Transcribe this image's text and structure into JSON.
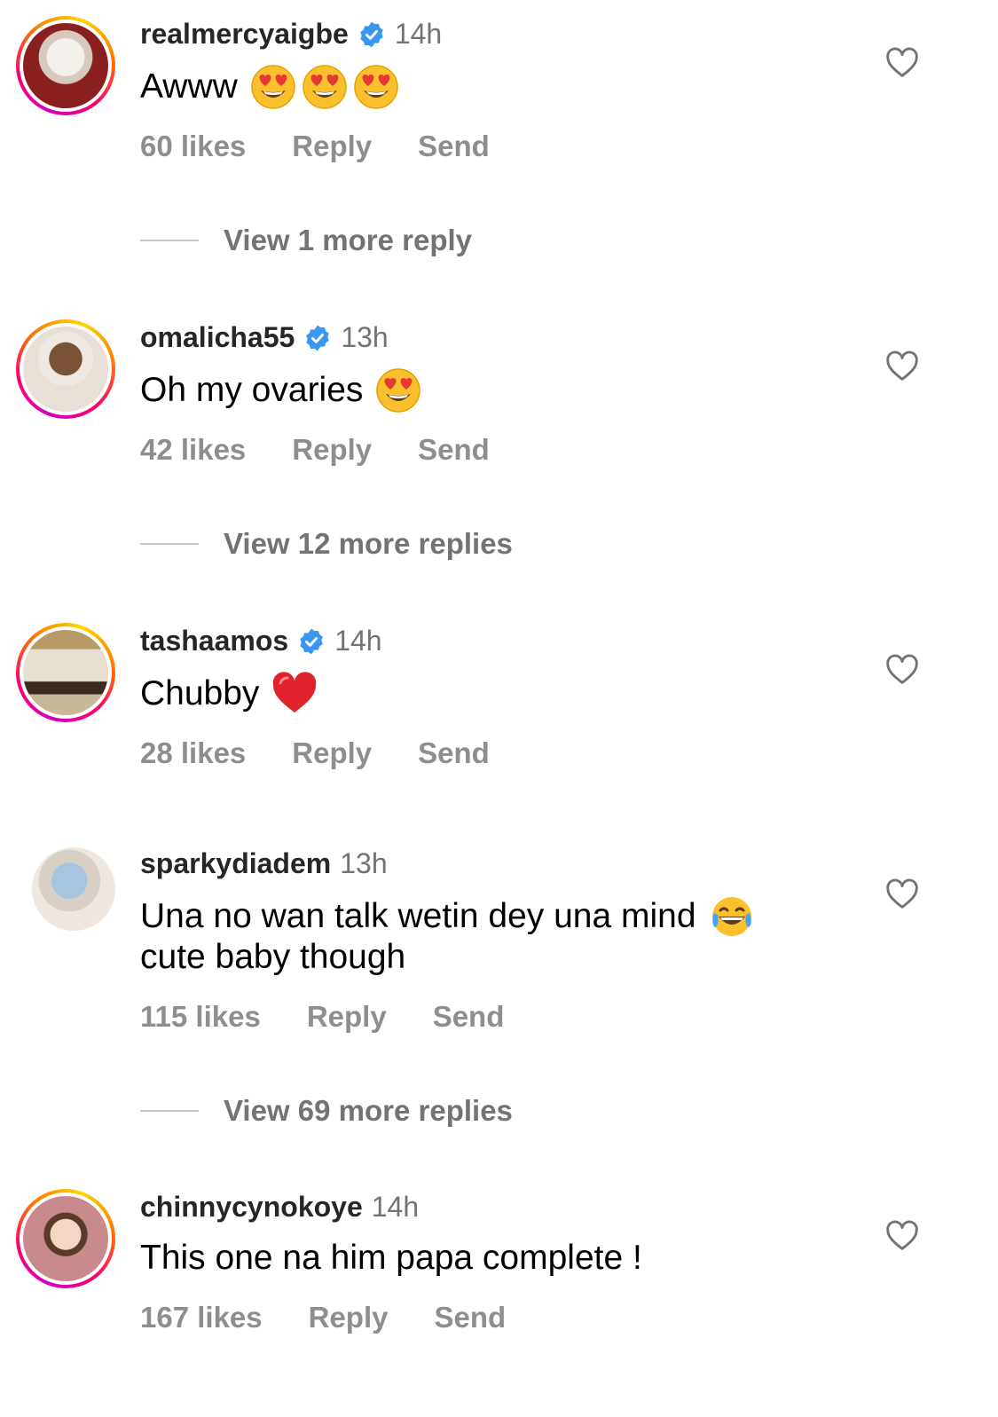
{
  "comments": [
    {
      "username": "realmercyaigbe",
      "verified": true,
      "time": "14h",
      "text": "Awww",
      "emojis": [
        "heart-eyes",
        "heart-eyes",
        "heart-eyes"
      ],
      "likes": "60 likes",
      "reply": "Reply",
      "send": "Send",
      "view_more": "View 1 more reply",
      "story_ring": true
    },
    {
      "username": "omalicha55",
      "verified": true,
      "time": "13h",
      "text": "Oh my ovaries",
      "emojis": [
        "heart-eyes"
      ],
      "likes": "42 likes",
      "reply": "Reply",
      "send": "Send",
      "view_more": "View 12 more replies",
      "story_ring": true
    },
    {
      "username": "tashaamos",
      "verified": true,
      "time": "14h",
      "text": "Chubby",
      "emojis": [
        "red-heart"
      ],
      "likes": "28 likes",
      "reply": "Reply",
      "send": "Send",
      "view_more": "",
      "story_ring": true
    },
    {
      "username": "sparkydiadem",
      "verified": false,
      "time": "13h",
      "text": "Una no wan talk wetin dey una mind",
      "text2": "cute baby though",
      "emojis": [
        "tears-of-joy"
      ],
      "likes": "115 likes",
      "reply": "Reply",
      "send": "Send",
      "view_more": "View 69 more replies",
      "story_ring": false
    },
    {
      "username": "chinnycynokoye",
      "verified": false,
      "time": "14h",
      "text": "This one na him papa complete !",
      "emojis": [],
      "likes": "167 likes",
      "reply": "Reply",
      "send": "Send",
      "view_more": "",
      "story_ring": true
    }
  ],
  "colors": {
    "verified": "#3897f0",
    "secondary": "#737373",
    "action": "#8e8e8e"
  }
}
